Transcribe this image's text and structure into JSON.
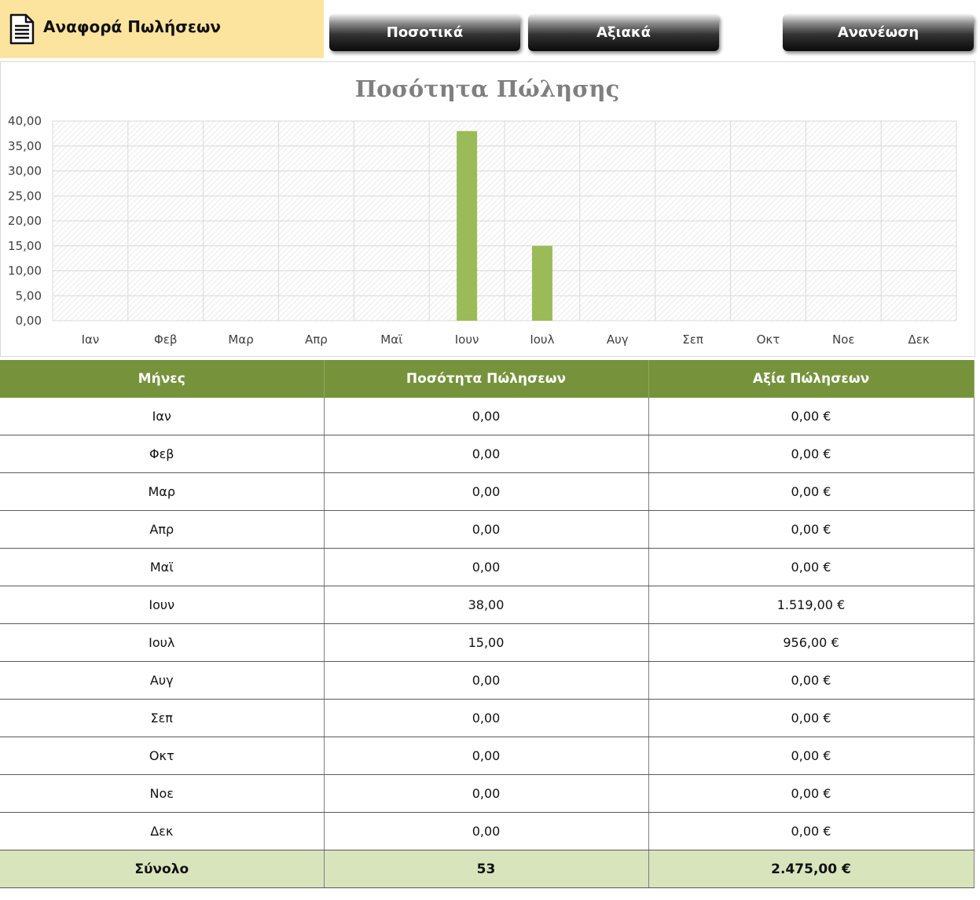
{
  "header": {
    "title": "Αναφορά Πωλήσεων",
    "title_bg": "#fde49e",
    "icon": "document-icon"
  },
  "buttons": {
    "quantities": "Ποσοτικά",
    "values": "Αξιακά",
    "refresh": "Ανανέωση"
  },
  "chart_data": {
    "type": "bar",
    "title": "Ποσότητα Πώλησης",
    "categories": [
      "Ιαν",
      "Φεβ",
      "Μαρ",
      "Απρ",
      "Μαϊ",
      "Ιουν",
      "Ιουλ",
      "Αυγ",
      "Σεπ",
      "Οκτ",
      "Νοε",
      "Δεκ"
    ],
    "values": [
      0,
      0,
      0,
      0,
      0,
      38,
      15,
      0,
      0,
      0,
      0,
      0
    ],
    "ylim": [
      0,
      40
    ],
    "yticks": [
      "0,00",
      "5,00",
      "10,00",
      "15,00",
      "20,00",
      "25,00",
      "30,00",
      "35,00",
      "40,00"
    ],
    "xlabel": "",
    "ylabel": "",
    "grid": true,
    "legend": "none",
    "bar_color": "#9bbb59"
  },
  "table": {
    "headers": [
      "Μήνες",
      "Ποσότητα Πώλησεων",
      "Αξία Πώλησεων"
    ],
    "header_color": "#76933c",
    "rows": [
      [
        "Ιαν",
        "0,00",
        "0,00 €"
      ],
      [
        "Φεβ",
        "0,00",
        "0,00 €"
      ],
      [
        "Μαρ",
        "0,00",
        "0,00 €"
      ],
      [
        "Απρ",
        "0,00",
        "0,00 €"
      ],
      [
        "Μαϊ",
        "0,00",
        "0,00 €"
      ],
      [
        "Ιουν",
        "38,00",
        "1.519,00 €"
      ],
      [
        "Ιουλ",
        "15,00",
        "956,00 €"
      ],
      [
        "Αυγ",
        "0,00",
        "0,00 €"
      ],
      [
        "Σεπ",
        "0,00",
        "0,00 €"
      ],
      [
        "Οκτ",
        "0,00",
        "0,00 €"
      ],
      [
        "Νοε",
        "0,00",
        "0,00 €"
      ],
      [
        "Δεκ",
        "0,00",
        "0,00 €"
      ]
    ],
    "total": [
      "Σύνολο",
      "53",
      "2.475,00 €"
    ],
    "total_color": "#d8e4bc"
  }
}
